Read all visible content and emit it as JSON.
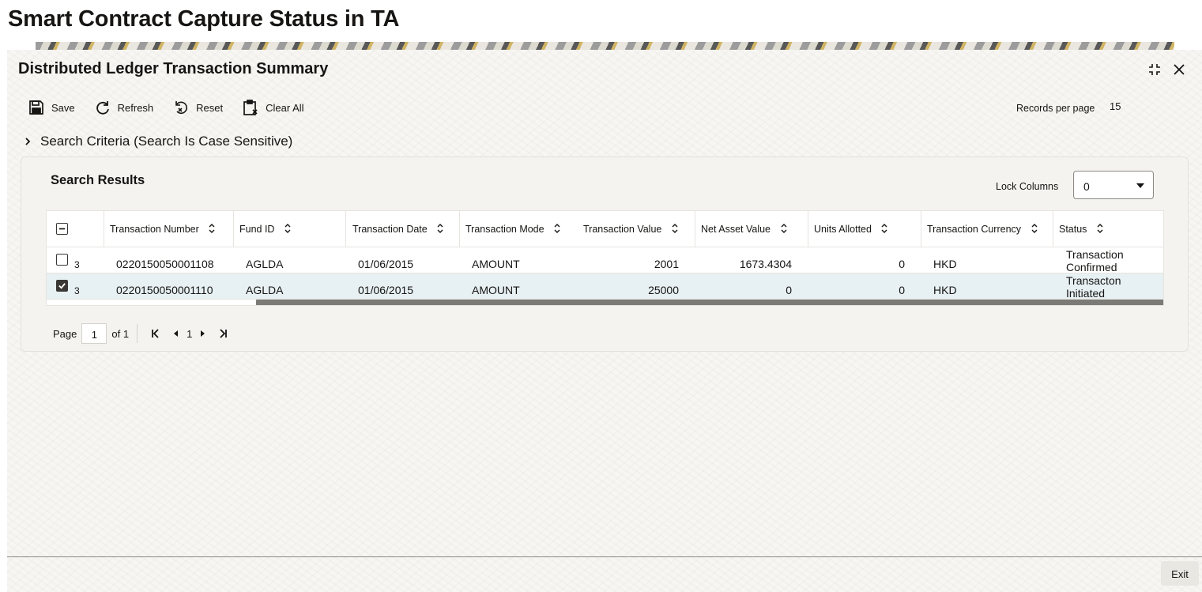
{
  "page": {
    "heading": "Smart Contract Capture Status in TA"
  },
  "window": {
    "title": "Distributed Ledger Transaction Summary",
    "maximize_icon": "maximize-icon",
    "close_icon": "close-icon"
  },
  "toolbar": {
    "save_label": "Save",
    "refresh_label": "Refresh",
    "reset_label": "Reset",
    "clear_all_label": "Clear All",
    "records_per_page_label": "Records per page",
    "records_per_page_value": "15"
  },
  "search_criteria": {
    "label": "Search Criteria (Search Is Case Sensitive)",
    "expanded": false
  },
  "results": {
    "title": "Search Results",
    "lock_columns_label": "Lock Columns",
    "lock_columns_value": "0",
    "columns": [
      "Transaction Number",
      "Fund ID",
      "Transaction Date",
      "Transaction Mode",
      "Transaction Value",
      "Net Asset Value",
      "Units Allotted",
      "Transaction Currency",
      "Status"
    ],
    "rows": [
      {
        "checked": false,
        "clipped_prefix": "3",
        "transaction_number": "0220150050001108",
        "fund_id": "AGLDA",
        "transaction_date": "01/06/2015",
        "transaction_mode": "AMOUNT",
        "transaction_value": "2001",
        "net_asset_value": "1673.4304",
        "units_allotted": "0",
        "transaction_currency": "HKD",
        "status": "Transaction Confirmed"
      },
      {
        "checked": true,
        "clipped_prefix": "3",
        "transaction_number": "0220150050001110",
        "fund_id": "AGLDA",
        "transaction_date": "01/06/2015",
        "transaction_mode": "AMOUNT",
        "transaction_value": "25000",
        "net_asset_value": "0",
        "units_allotted": "0",
        "transaction_currency": "HKD",
        "status": "Transacton Initiated"
      }
    ]
  },
  "pager": {
    "page_label": "Page",
    "page_value": "1",
    "of_label": "of 1",
    "current_page": "1"
  },
  "footer": {
    "exit_label": "Exit"
  }
}
